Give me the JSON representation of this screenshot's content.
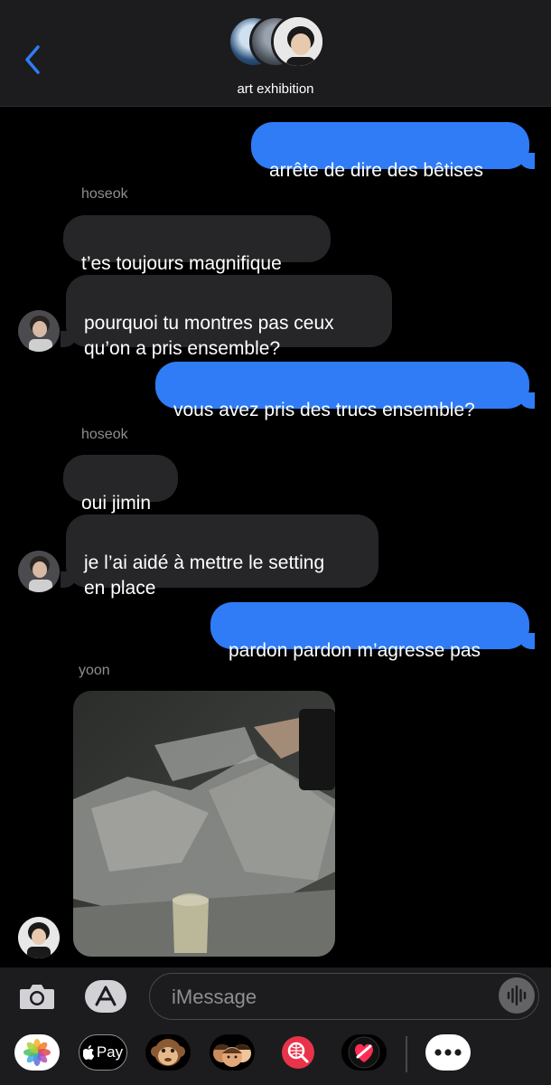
{
  "header": {
    "group_name": "art exhibition",
    "back_icon": "chevron-left-icon",
    "accent": "#2f7cf6"
  },
  "thread": {
    "messages": [
      {
        "direction": "outgoing",
        "text": "arrête de dire des bêtises"
      },
      {
        "direction": "incoming",
        "sender": "hoseok",
        "text": "t’es toujours magnifique"
      },
      {
        "direction": "incoming",
        "text": "pourquoi tu montres pas ceux\nqu’on a pris ensemble?"
      },
      {
        "direction": "outgoing",
        "text": "vous avez pris des trucs ensemble?"
      },
      {
        "direction": "incoming",
        "sender": "hoseok",
        "text": "oui jimin"
      },
      {
        "direction": "incoming",
        "text": "je l’ai aidé à mettre le setting\nen place"
      },
      {
        "direction": "outgoing",
        "text": "pardon pardon m’agresse pas"
      },
      {
        "direction": "incoming",
        "sender": "yoon",
        "attachment": "photo"
      }
    ]
  },
  "composer": {
    "placeholder": "iMessage",
    "value": "",
    "camera_icon": "camera-icon",
    "apps_icon": "app-store-icon",
    "audio_icon": "waveform-icon"
  },
  "app_drawer": {
    "apple_pay_label": "Pay",
    "apps": [
      "photos-icon",
      "apple-pay-icon",
      "monkey-icon",
      "memoji-icon",
      "web-search-icon",
      "digital-touch-icon",
      "more-icon"
    ]
  }
}
